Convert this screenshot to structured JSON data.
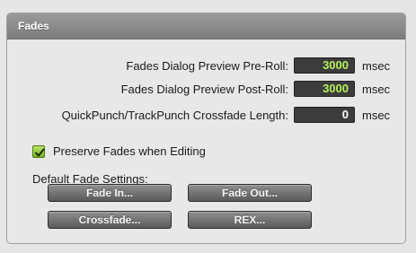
{
  "panel": {
    "title": "Fades"
  },
  "settings": [
    {
      "label": "Fades Dialog Preview Pre-Roll:",
      "value": "3000",
      "unit": "msec"
    },
    {
      "label": "Fades Dialog Preview Post-Roll:",
      "value": "3000",
      "unit": "msec"
    },
    {
      "label": "QuickPunch/TrackPunch Crossfade Length:",
      "value": "0",
      "unit": "msec"
    }
  ],
  "preserve_fades": {
    "label": "Preserve Fades when Editing",
    "checked": true
  },
  "default_fade": {
    "label": "Default Fade Settings:",
    "buttons": [
      "Fade In...",
      "Fade Out...",
      "Crossfade...",
      "REX..."
    ]
  },
  "colors": {
    "header": "#8a8a8a",
    "value_green": "#b6f05a",
    "checkbox_green": "#8cc43a"
  }
}
